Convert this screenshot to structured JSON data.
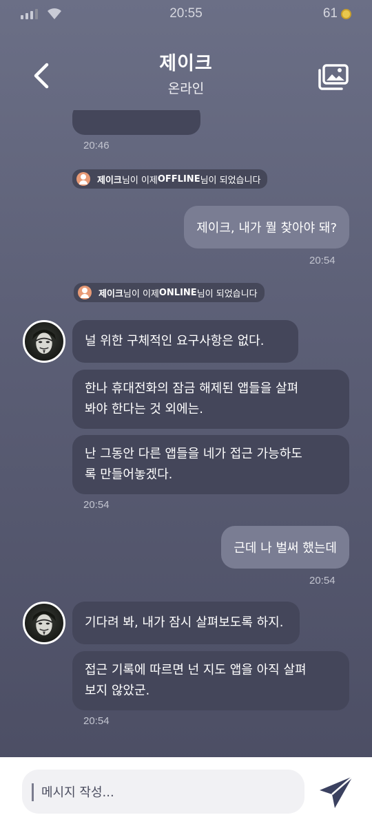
{
  "status": {
    "time": "20:55",
    "battery": "61"
  },
  "header": {
    "title": "제이크",
    "subtitle": "온라인"
  },
  "messages": {
    "t0": "20:46",
    "notice1": {
      "name": "제이크",
      "mid": "님이 이제 ",
      "state": "OFFLINE",
      "end": "님이 되었습니다"
    },
    "out1": "제이크, 내가 뭘 찾아야 돼?",
    "t1": "20:54",
    "notice2": {
      "name": "제이크",
      "mid": "님이 이제 ",
      "state": "ONLINE",
      "end": "님이 되었습니다"
    },
    "in1": "널 위한 구체적인 요구사항은 없다.",
    "in2_l1": "한나 휴대전화의 잠금 해제된 앱들을 살펴",
    "in2_l2": "봐야 한다는 것 외에는.",
    "in3_l1": "난 그동안 다른 앱들을 네가 접근 가능하도",
    "in3_l2": "록 만들어놓겠다.",
    "t2": "20:54",
    "out2": "근데 나 벌써 했는데",
    "t3": "20:54",
    "in4": "기다려 봐, 내가 잠시 살펴보도록 하지.",
    "in5_l1": "접근 기록에 따르면 넌 지도 앱을 아직 살펴",
    "in5_l2": "보지 않았군.",
    "t4": "20:54"
  },
  "composer": {
    "placeholder": "메시지 작성..."
  },
  "icons": {
    "back": "chevron-left-icon",
    "gallery": "gallery-icon",
    "send": "send-icon"
  },
  "colors": {
    "incoming_bubble": "#44465a",
    "outgoing_bubble": "#7a7d93",
    "notice_icon": "#e89a76",
    "send": "#3b4160"
  }
}
